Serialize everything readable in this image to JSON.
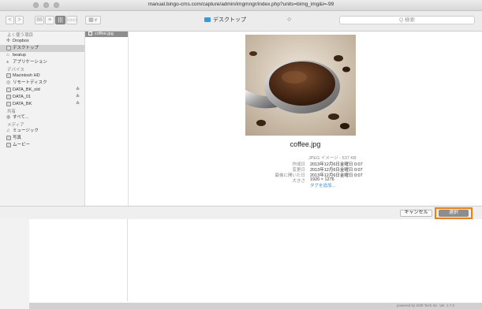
{
  "window": {
    "url": "manual.bingo-cms.com/capture/admin/imgmngr/index.php?units=bimg_img&i=-99"
  },
  "toolbar": {
    "back": "<",
    "forward": ">",
    "view_icons": "88",
    "view_list": "≡",
    "view_columns": "|||",
    "view_cover": "▭▭",
    "arrange": "▦∨",
    "location": "デスクトップ",
    "location_chevron": "◇",
    "search_placeholder": "Q 検索"
  },
  "sidebar": {
    "favorites_header": "よく使う項目",
    "favorites": [
      {
        "label": "Dropbox",
        "icon": "dropbox-icon"
      },
      {
        "label": "デスクトップ",
        "icon": "desktop-icon"
      },
      {
        "label": "beatup",
        "icon": "home-icon"
      },
      {
        "label": "アプリケーション",
        "icon": "applications-icon"
      }
    ],
    "devices_header": "デバイス",
    "devices": [
      {
        "label": "Macintosh HD",
        "icon": "disk-icon",
        "eject": ""
      },
      {
        "label": "リモートディスク",
        "icon": "remote-disc-icon",
        "eject": ""
      },
      {
        "label": "DATA_BK_old",
        "icon": "disk-icon",
        "eject": "≜"
      },
      {
        "label": "DATA_01",
        "icon": "disk-icon",
        "eject": "≜"
      },
      {
        "label": "DATA_BK",
        "icon": "disk-icon",
        "eject": "≜"
      }
    ],
    "shared_header": "共有",
    "shared": [
      {
        "label": "すべて...",
        "icon": "network-icon"
      }
    ],
    "media_header": "メディア",
    "media": [
      {
        "label": "ミュージック",
        "icon": "music-icon"
      },
      {
        "label": "写真",
        "icon": "photo-icon"
      },
      {
        "label": "ムービー",
        "icon": "movie-icon"
      }
    ]
  },
  "browser": {
    "file": "coffee.jpg"
  },
  "preview": {
    "filename": "coffee.jpg",
    "kind": "JPEG イメージ - 537 KB",
    "rows": [
      {
        "key": "作成日",
        "value": "2013年12月6日金曜日 0:07"
      },
      {
        "key": "変更日",
        "value": "2013年12月6日金曜日 0:07"
      },
      {
        "key": "最後に開いた日",
        "value": "2013年12月6日金曜日 0:07"
      },
      {
        "key": "大きさ",
        "value": "1920 × 1276"
      }
    ],
    "add_tag": "タグを追加..."
  },
  "footer": {
    "cancel": "キャンセル",
    "choose": "選択"
  },
  "page_footer": "powered by Shift Tech Inc. Ver. 1.7.0"
}
